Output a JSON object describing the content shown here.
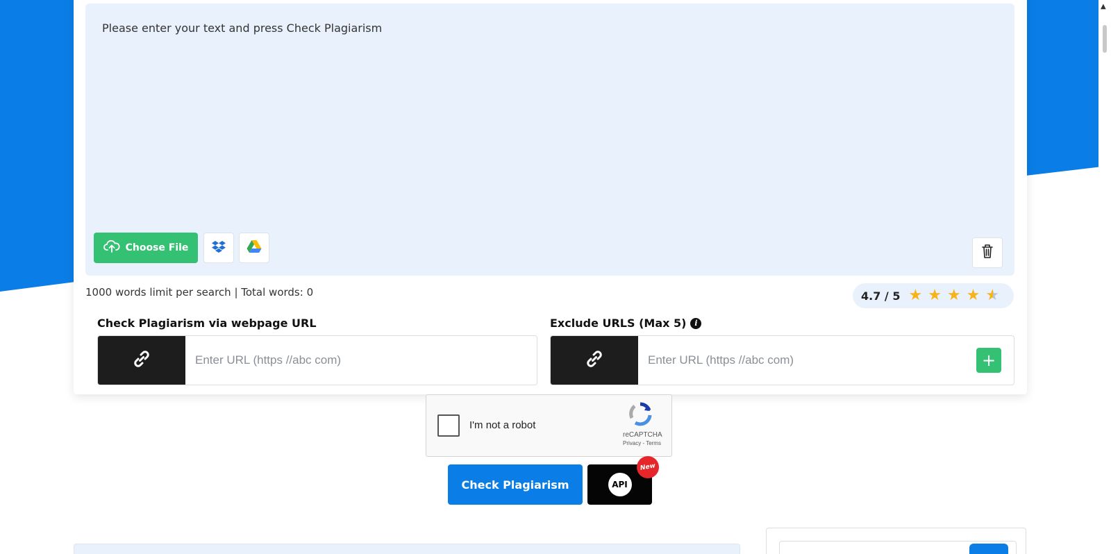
{
  "editor": {
    "placeholder": "Please enter your text and press Check Plagiarism",
    "choose_file_label": "Choose File",
    "dropbox_icon": "dropbox-icon",
    "drive_icon": "google-drive-icon",
    "clear_icon": "trash-icon"
  },
  "stats": {
    "word_limit_text": "1000 words limit per search | Total words: 0"
  },
  "rating": {
    "value_text": "4.7 / 5",
    "stars": 4.7,
    "star_glyph": "★"
  },
  "url_check": {
    "label": "Check Plagiarism via webpage URL",
    "placeholder": "Enter URL (https //abc com)"
  },
  "exclude": {
    "label": "Exclude URLS (Max 5)",
    "info_glyph": "i",
    "placeholder": "Enter URL (https //abc com)",
    "add_glyph": "+"
  },
  "captcha": {
    "label": "I'm not a robot",
    "brand": "reCAPTCHA",
    "links": "Privacy - Terms"
  },
  "actions": {
    "check_label": "Check Plagiarism",
    "api_label": "API",
    "new_badge": "New"
  },
  "colors": {
    "primary_blue": "#0a7ee6",
    "green": "#34c173",
    "editor_bg": "#e9f1fd",
    "star": "#f6b41a",
    "badge_red": "#e5262a"
  }
}
